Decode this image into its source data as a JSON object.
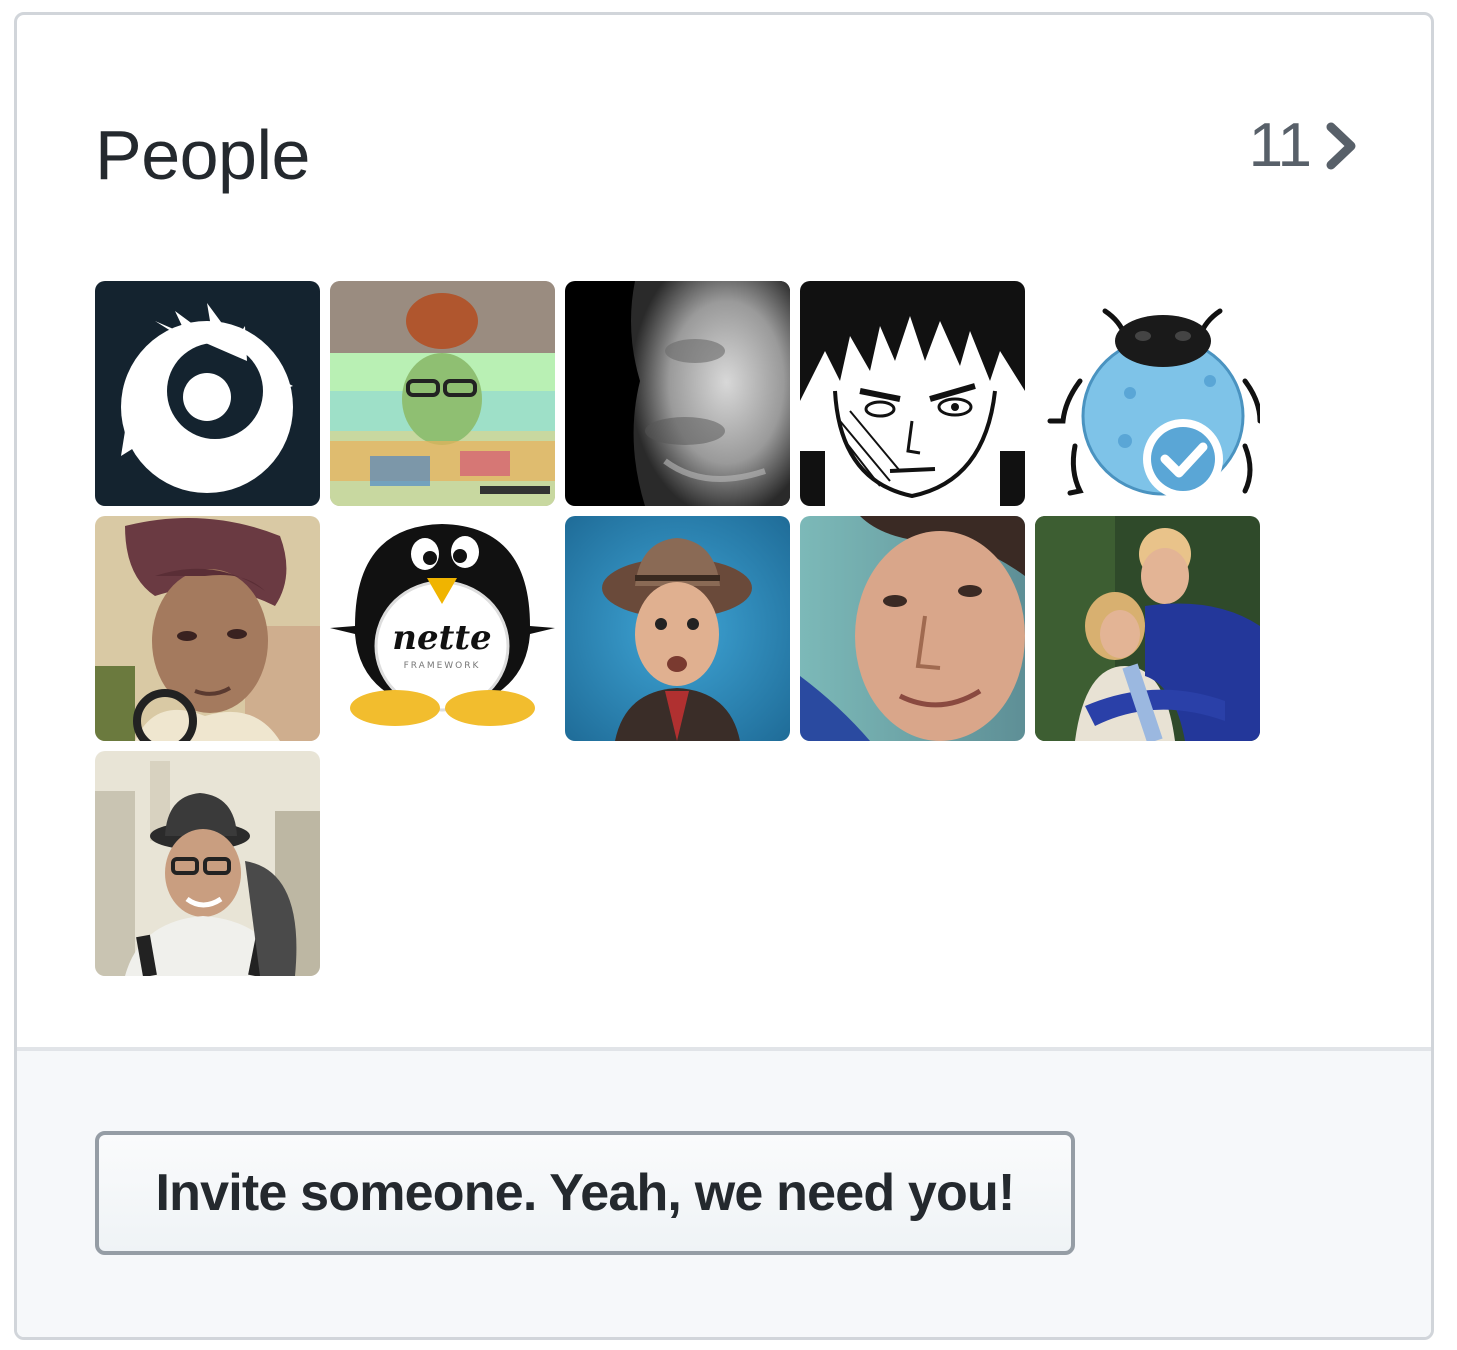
{
  "people": {
    "title": "People",
    "count": "11",
    "avatars": [
      {
        "label": "member avatar 1",
        "icon": "dragon-logo"
      },
      {
        "label": "member avatar 2",
        "icon": "glitch-photo"
      },
      {
        "label": "member avatar 3",
        "icon": "stone-face"
      },
      {
        "label": "member avatar 4",
        "icon": "manga-face"
      },
      {
        "label": "member avatar 5",
        "icon": "blue-bug"
      },
      {
        "label": "member avatar 6",
        "icon": "sepia-portrait"
      },
      {
        "label": "member avatar 7",
        "icon": "nette-penguin",
        "text": "nette",
        "subtext": "FRAMEWORK"
      },
      {
        "label": "member avatar 8",
        "icon": "hat-portrait"
      },
      {
        "label": "member avatar 9",
        "icon": "closeup-portrait"
      },
      {
        "label": "member avatar 10",
        "icon": "couple-photo"
      },
      {
        "label": "member avatar 11",
        "icon": "traveler-photo"
      }
    ]
  },
  "footer": {
    "invite_label": "Invite someone. Yeah, we need you!"
  },
  "colors": {
    "border": "#d1d5da",
    "footer_bg": "#f6f8fa",
    "text": "#24292e",
    "muted": "#586069"
  }
}
